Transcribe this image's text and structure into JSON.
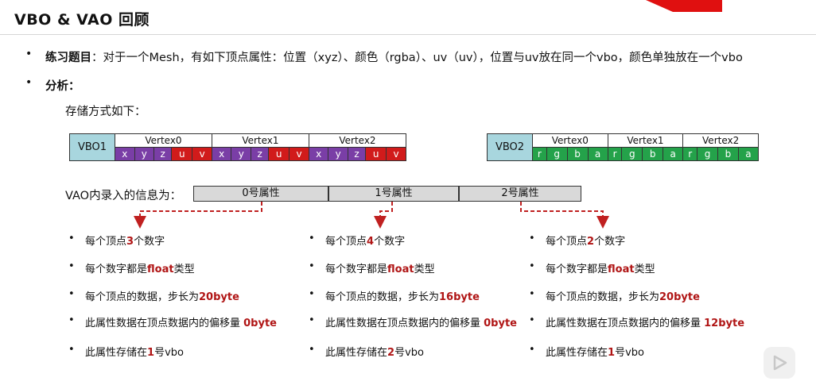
{
  "title": "VBO & VAO 回顾",
  "bullets": {
    "exercise_label": "练习题目",
    "exercise_text": "：对于一个Mesh，有如下顶点属性：位置（xyz）、颜色（rgba）、uv（uv），位置与uv放在同一个vbo，颜色单独放在一个vbo",
    "analysis_label": "分析："
  },
  "storage_label": "存储方式如下：",
  "vbo1": {
    "name": "VBO1",
    "vertices": [
      "Vertex0",
      "Vertex1",
      "Vertex2"
    ],
    "components": [
      "x",
      "y",
      "z",
      "u",
      "v"
    ]
  },
  "vbo2": {
    "name": "VBO2",
    "vertices": [
      "Vertex0",
      "Vertex1",
      "Vertex2"
    ],
    "components": [
      "r",
      "g",
      "b",
      "a"
    ]
  },
  "vao": {
    "label": "VAO内录入的信息为：",
    "attrs": [
      "0号属性",
      "1号属性",
      "2号属性"
    ]
  },
  "columns": [
    {
      "items": [
        {
          "pre": "每个顶点",
          "hl": "3",
          "post": "个数字"
        },
        {
          "pre": "每个数字都是",
          "hl": "float",
          "post": "类型"
        },
        {
          "pre": "每个顶点的数据，步长为",
          "hl": "20byte",
          "post": ""
        },
        {
          "pre": "此属性数据在顶点数据内的偏移量 ",
          "hl": "0byte",
          "post": ""
        },
        {
          "pre": "此属性存储在",
          "hl": "1",
          "post": "号vbo"
        }
      ]
    },
    {
      "items": [
        {
          "pre": "每个顶点",
          "hl": "4",
          "post": "个数字"
        },
        {
          "pre": "每个数字都是",
          "hl": "float",
          "post": "类型"
        },
        {
          "pre": "每个顶点的数据，步长为",
          "hl": "16byte",
          "post": ""
        },
        {
          "pre": "此属性数据在顶点数据内的偏移量 ",
          "hl": "0byte",
          "post": ""
        },
        {
          "pre": "此属性存储在",
          "hl": "2",
          "post": "号vbo"
        }
      ]
    },
    {
      "items": [
        {
          "pre": "每个顶点",
          "hl": "2",
          "post": "个数字"
        },
        {
          "pre": "每个数字都是",
          "hl": "float",
          "post": "类型"
        },
        {
          "pre": "每个顶点的数据，步长为",
          "hl": "20byte",
          "post": ""
        },
        {
          "pre": "此属性数据在顶点数据内的偏移量 ",
          "hl": "12byte",
          "post": ""
        },
        {
          "pre": "此属性存储在",
          "hl": "1",
          "post": "号vbo"
        }
      ]
    }
  ],
  "colors": {
    "position": "#7a3ea6",
    "uv": "#d11b1b",
    "color_attr": "#24a24a",
    "vbo_label_bg": "#a8d6de",
    "highlight": "#b01515",
    "arrow": "#c02020"
  }
}
